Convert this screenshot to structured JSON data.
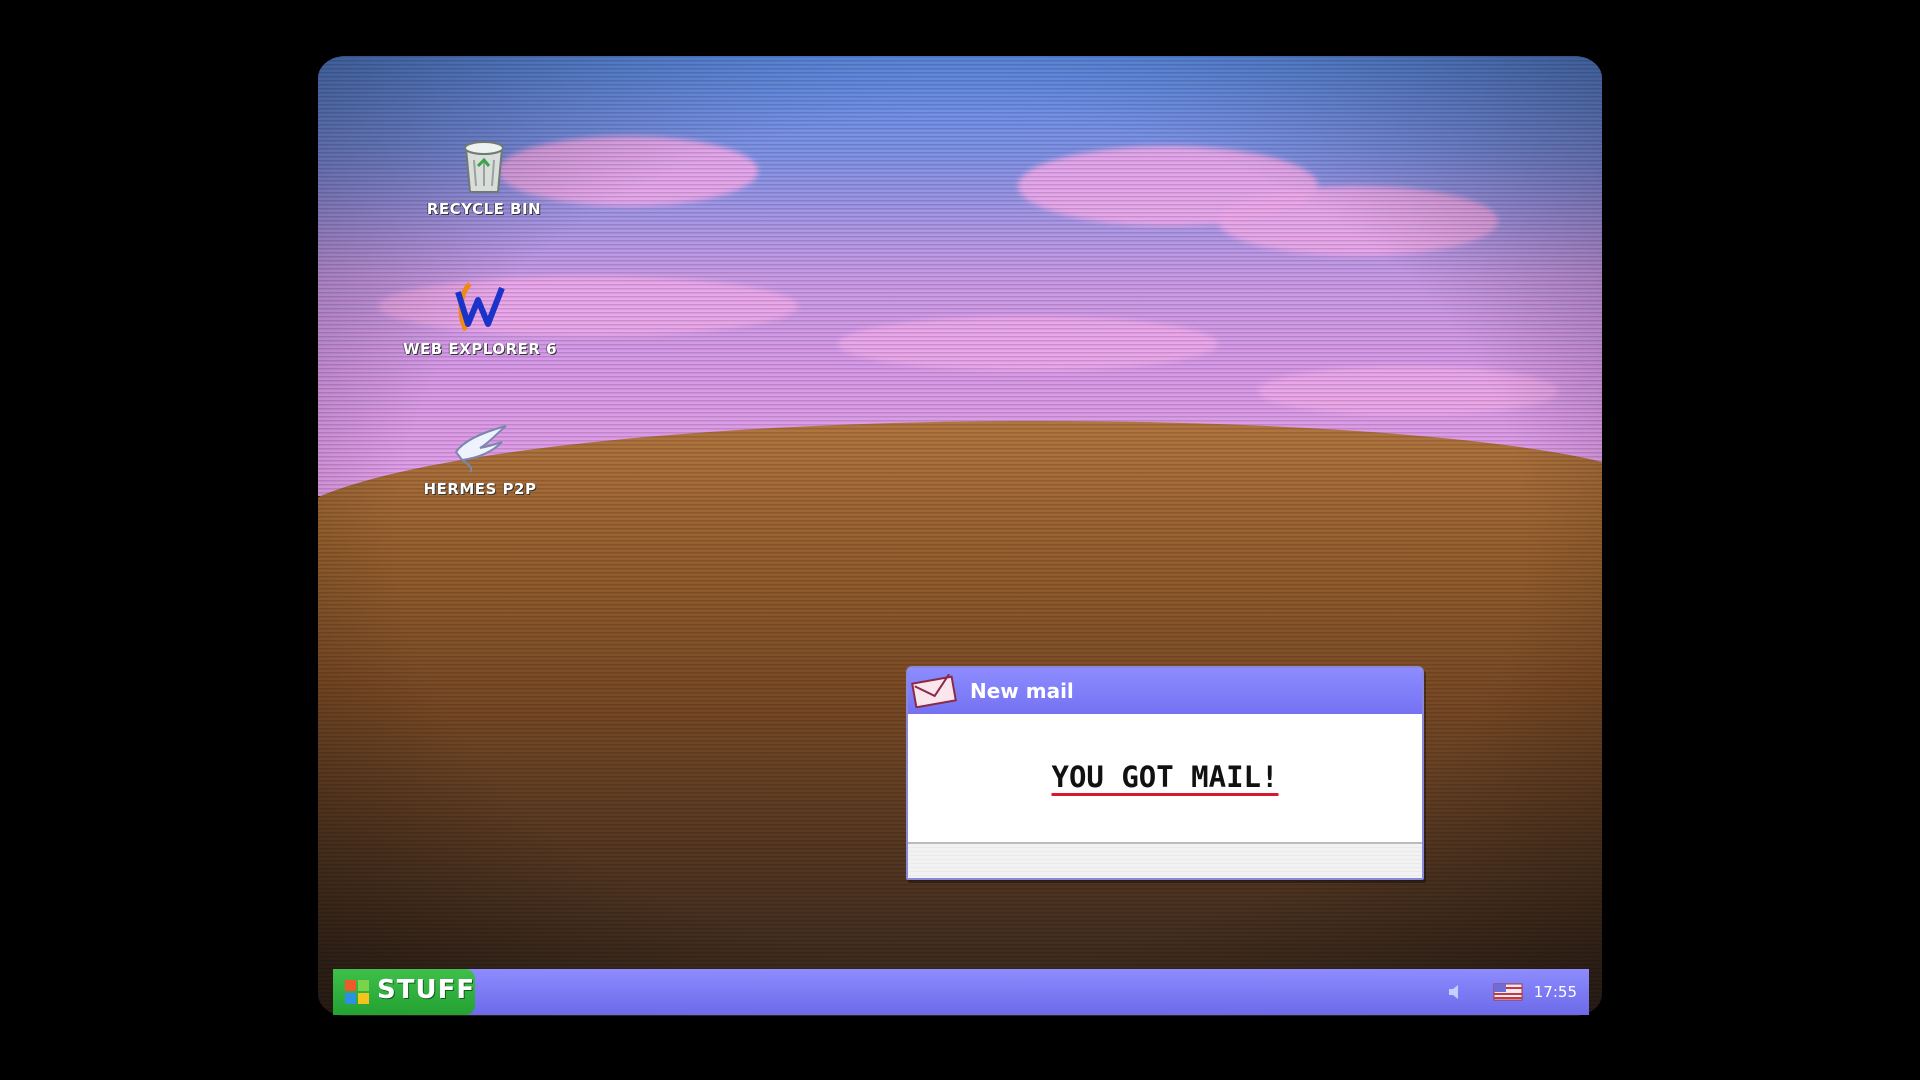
{
  "desktop": {
    "icons": [
      {
        "label": "RECYCLE BIN",
        "icon": "recycle-bin-icon"
      },
      {
        "label": "WEB EXPLORER 6",
        "icon": "web-explorer-icon"
      },
      {
        "label": "HERMES P2P",
        "icon": "hermes-p2p-icon"
      }
    ]
  },
  "popup": {
    "title": "New mail",
    "message": "YOU GOT MAIL!",
    "icon": "envelope-icon"
  },
  "taskbar": {
    "start_label": "STUFF",
    "clock": "17:55",
    "tray_icons": [
      "speaker-icon",
      "flag-icon"
    ]
  },
  "colors": {
    "titlebar": "#7f7df5",
    "start_button": "#2fb03d",
    "underline": "#d8182c"
  }
}
